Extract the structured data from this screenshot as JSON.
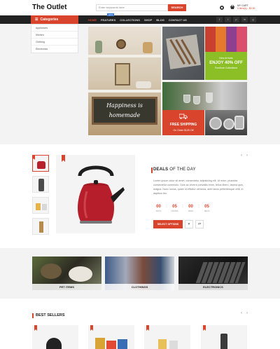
{
  "header": {
    "logo": "The Outlet",
    "search_placeholder": "Enter keywords here",
    "search_button": "SEARCH",
    "cart_label": "MY CART",
    "cart_amount": "0 item(s) - $0.00"
  },
  "nav": {
    "categories_label": "Categories",
    "items": [
      "HOME",
      "FEATURES",
      "COLLECTIONS",
      "SHOP",
      "BLOG",
      "CONTACT US"
    ],
    "badge": "HOT",
    "social": [
      "f",
      "t",
      "p",
      "in",
      "g"
    ]
  },
  "category_menu": [
    "Appliances",
    "Kitchen",
    "Clothing",
    "Electronics"
  ],
  "banners": {
    "interior_sign": "Happiness is homemade",
    "new_arrivals": {
      "line1": "New Arrivals",
      "line2": "ENJOY 40% OFF",
      "line3": "Furniture Collections"
    },
    "shipping": {
      "title": "FREE SHIPPING",
      "subtitle": "On Order $129 Off"
    }
  },
  "deal": {
    "title_bold": "DEALS",
    "title_rest": " OF THE DAY",
    "description": "Lorem ipsum dolor sit amet, consectetur adipisicing elit. Ut enim, pharetra consectetur commodo. Duis ac viverra convallis enim, tellus libero, lacinia quis, magna. Nunc luctus, quam id efficitur vehicula, ante lacus pellentesque velit, in dapibus leo.",
    "counters": [
      {
        "value": "00",
        "label": "DAYS"
      },
      {
        "value": "05",
        "label": "HOURS"
      },
      {
        "value": "00",
        "label": "MINS"
      },
      {
        "value": "05",
        "label": "SECS"
      }
    ],
    "button": "SELECT OPTIONS",
    "wishlist_icon": "heart-icon",
    "compare_icon": "compare-icon"
  },
  "category_tiles": [
    "PET ITEMS",
    "CLOTHINGS",
    "ELECTRONICS"
  ],
  "best_sellers": {
    "title": "BEST SELLERS"
  },
  "colors": {
    "accent": "#d9442c",
    "dark": "#222222",
    "green": "#8cbf26"
  }
}
